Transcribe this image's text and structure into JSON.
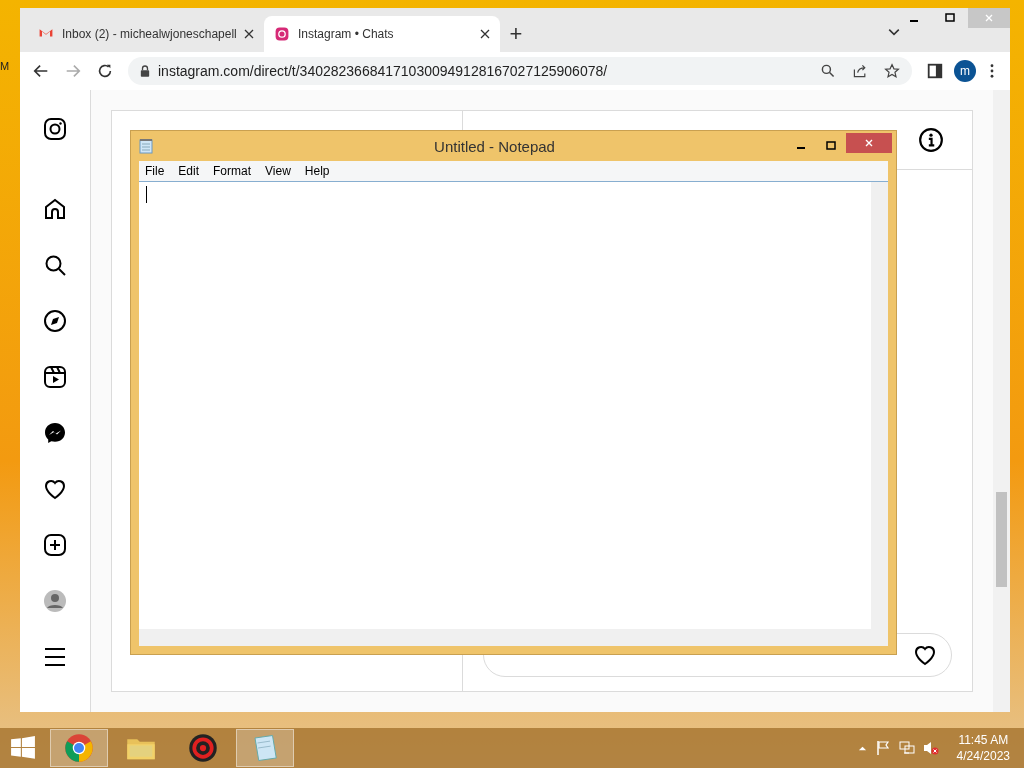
{
  "desktop": {
    "edge_text": "M"
  },
  "browser": {
    "tabs": [
      {
        "kind": "mail",
        "title": "Inbox (2) - michealwjoneschapell",
        "selected": false
      },
      {
        "kind": "instagram",
        "title": "Instagram • Chats",
        "selected": true
      }
    ],
    "new_tab": "+",
    "address": "instagram.com/direct/t/340282366841710300949128167027125906078/",
    "profile": "m"
  },
  "sidebar": {
    "items": [
      {
        "kind": "logo"
      },
      {
        "kind": "home"
      },
      {
        "kind": "search"
      },
      {
        "kind": "explore"
      },
      {
        "kind": "reels"
      },
      {
        "kind": "messenger"
      },
      {
        "kind": "heart"
      },
      {
        "kind": "create"
      },
      {
        "kind": "avatar"
      },
      {
        "kind": "menu"
      }
    ]
  },
  "notepad": {
    "title": "Untitled - Notepad",
    "menu": [
      "File",
      "Edit",
      "Format",
      "View",
      "Help"
    ]
  },
  "taskbar": {
    "apps": [
      {
        "kind": "chrome",
        "active": true
      },
      {
        "kind": "explorer",
        "active": false
      },
      {
        "kind": "red",
        "active": false
      },
      {
        "kind": "notepad",
        "active": true
      }
    ],
    "time": "11:45 AM",
    "date": "4/24/2023"
  }
}
